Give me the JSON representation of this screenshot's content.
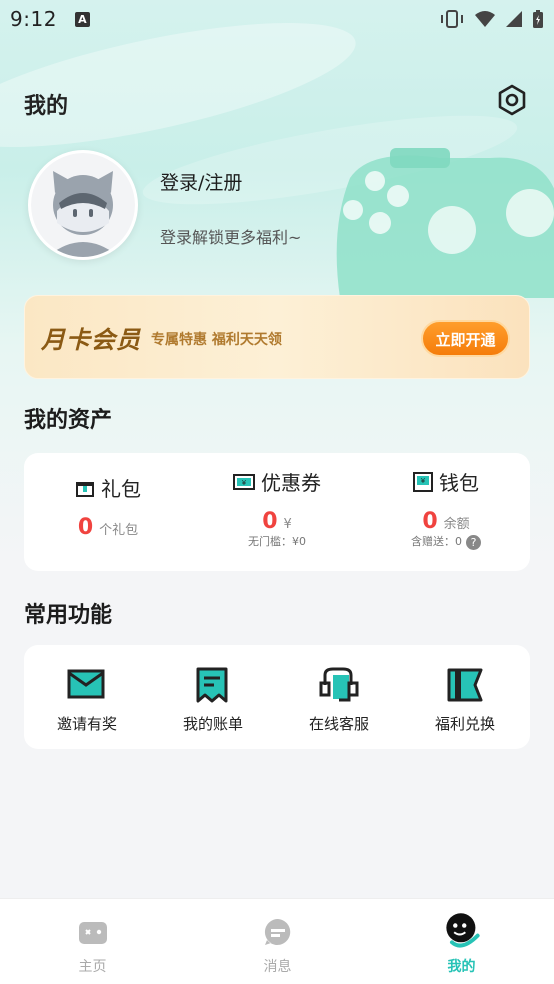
{
  "status_bar": {
    "time": "9:12",
    "app_notif": "A"
  },
  "header": {
    "title": "我的"
  },
  "profile": {
    "login_label": "登录/注册",
    "subtitle": "登录解锁更多福利~"
  },
  "vip": {
    "title": "月卡会员",
    "subtitle": "专属特惠 福利天天领",
    "button": "立即开通"
  },
  "assets": {
    "section_title": "我的资产",
    "items": [
      {
        "label": "礼包",
        "value": "0",
        "unit": "个礼包",
        "note": ""
      },
      {
        "label": "优惠券",
        "value": "0",
        "unit": "¥",
        "note": "无门槛：¥0"
      },
      {
        "label": "钱包",
        "value": "0",
        "unit": "余额",
        "note": "含赠送：0"
      }
    ]
  },
  "functions": {
    "section_title": "常用功能",
    "items": [
      {
        "label": "邀请有奖"
      },
      {
        "label": "我的账单"
      },
      {
        "label": "在线客服"
      },
      {
        "label": "福利兑换"
      }
    ]
  },
  "nav": {
    "items": [
      {
        "label": "主页"
      },
      {
        "label": "消息"
      },
      {
        "label": "我的"
      }
    ]
  },
  "colors": {
    "accent": "#27c3b6",
    "value_red": "#f0433f",
    "vip_button": "#f57d0b"
  }
}
